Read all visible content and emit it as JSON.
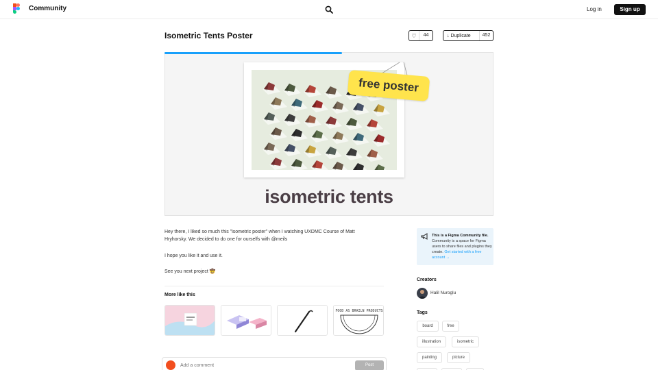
{
  "header": {
    "brand": "Community",
    "login": "Log in",
    "signup": "Sign up"
  },
  "file": {
    "title": "Isometric Tents Poster",
    "likes": "44",
    "duplicate_label": "Duplicate",
    "duplicates": "452"
  },
  "preview": {
    "sticker": "free poster",
    "poster_title": "isometric tents",
    "load_progress": 0.54
  },
  "description": {
    "p1": "Hey there, I liked so much this \"isometric poster\" when I watching UXDMC Course of Matt Hryhorsky. We decided to do one for ourselfs with @meils",
    "p2": "I hope you like it and use it.",
    "p3": "See you next project 🤠"
  },
  "more_like_this": {
    "title": "More like this"
  },
  "comment": {
    "placeholder": "Add a comment",
    "post": "Post"
  },
  "info": {
    "bold": "This is a Figma Community file.",
    "text": "Community is a space for Figma users to share files and plugins they create.",
    "link": "Get started with a free account →"
  },
  "creators": {
    "title": "Creators",
    "name": "Halil Nuroglu"
  },
  "tags": {
    "title": "Tags",
    "items": [
      "board",
      "free",
      "illustration",
      "isometric",
      "painting",
      "picture"
    ]
  },
  "colors": {
    "accent": "#18a0fb",
    "sticker": "#ffe44c",
    "poster_bg": "#e6ecdf",
    "poster_title": "#4a3e45"
  }
}
